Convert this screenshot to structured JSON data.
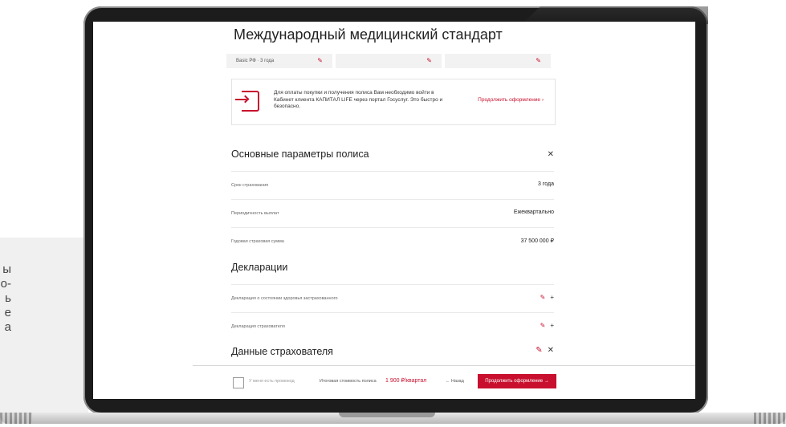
{
  "side_text": [
    "ы",
    "о-",
    "",
    "ь",
    "е",
    "а"
  ],
  "page": {
    "title": "Международный медицинский стандарт",
    "steps": [
      {
        "label": "Basic РФ · 3 года"
      },
      {
        "label": ""
      },
      {
        "label": ""
      }
    ],
    "notice": {
      "message": "Для оплаты покупки и получения полиса Вам необходимо войти в Кабинет клиента КАПИТАЛ LIFE через портал Госуслуг. Это быстро и безопасно.",
      "cta": "Продолжить оформление ›"
    },
    "sections": {
      "policy": {
        "title": "Основные параметры полиса",
        "rows": [
          {
            "label": "Срок страхования",
            "value": "3 года"
          },
          {
            "label": "Периодичность выплат",
            "value": "Ежеквартально"
          },
          {
            "label": "Годовая страховая сумма",
            "value": "37 500 000 ₽"
          }
        ]
      },
      "declarations": {
        "title": "Декларации",
        "rows": [
          {
            "label": "Декларация о состоянии здоровья застрахованного"
          },
          {
            "label": "Декларация страхователя"
          }
        ]
      },
      "insurer": {
        "title": "Данные страхователя"
      }
    },
    "bottom": {
      "promo": "У меня есть промокод",
      "total_label": "Итоговая стоимость полиса",
      "total_value": "1 900 ₽/квартал",
      "back": "← Назад",
      "continue": "Продолжить оформление →"
    }
  }
}
